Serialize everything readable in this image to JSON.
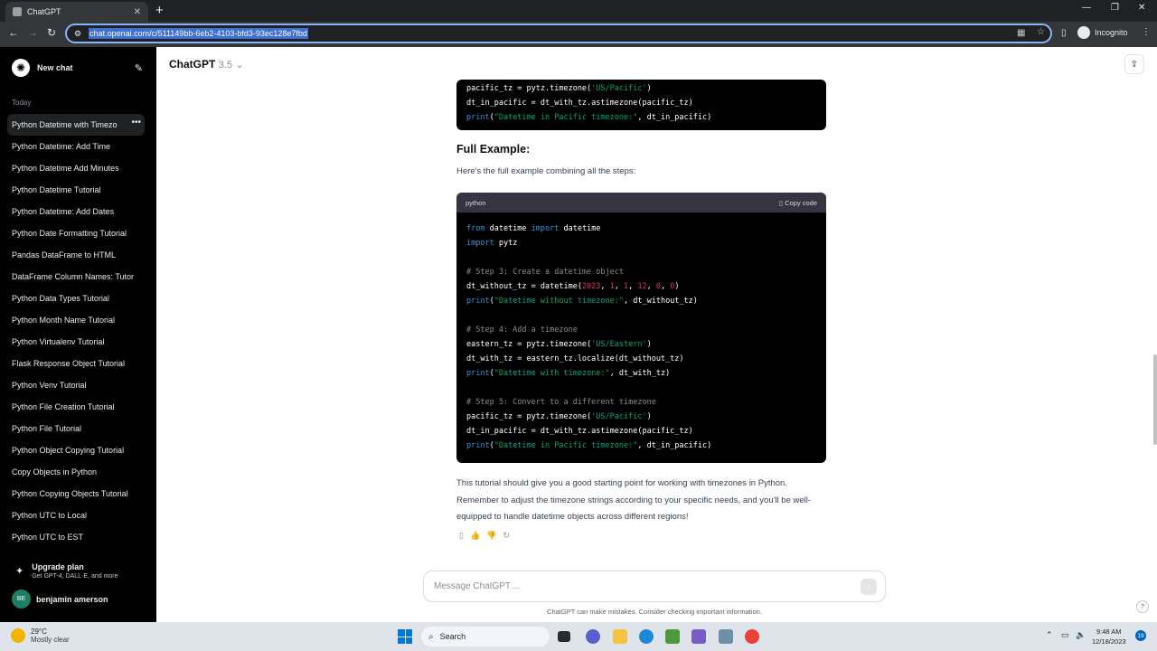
{
  "browser": {
    "tab_title": "ChatGPT",
    "url": "chat.openai.com/c/511149bb-6eb2-4103-bfd3-93ec128e7fbd",
    "profile": "Incognito"
  },
  "sidebar": {
    "new_chat": "New chat",
    "section": "Today",
    "items": [
      "Python Datetime with Timezo",
      "Python Datetime: Add Time",
      "Python Datetime Add Minutes",
      "Python Datetime Tutorial",
      "Python Datetime: Add Dates",
      "Python Date Formatting Tutorial",
      "Pandas DataFrame to HTML",
      "DataFrame Column Names: Tutor",
      "Python Data Types Tutorial",
      "Python Month Name Tutorial",
      "Python Virtualenv Tutorial",
      "Flask Response Object Tutorial",
      "Python Venv Tutorial",
      "Python File Creation Tutorial",
      "Python File Tutorial",
      "Python Object Copying Tutorial",
      "Copy Objects in Python",
      "Python Copying Objects Tutorial",
      "Python UTC to Local",
      "Python UTC to EST"
    ],
    "upgrade_title": "Upgrade plan",
    "upgrade_sub": "Get GPT-4, DALL·E, and more",
    "user_initials": "BE",
    "user_name": "benjamin amerson"
  },
  "header": {
    "model": "ChatGPT",
    "version": "3.5"
  },
  "content": {
    "top_code": [
      "pacific_tz = pytz.timezone('US/Pacific')",
      "dt_in_pacific = dt_with_tz.astimezone(pacific_tz)",
      "print(\"Datetime in Pacific timezone:\", dt_in_pacific)"
    ],
    "heading": "Full Example:",
    "intro": "Here's the full example combining all the steps:",
    "code_lang": "python",
    "copy_label": "Copy code",
    "outro": "This tutorial should give you a good starting point for working with timezones in Python. Remember to adjust the timezone strings according to your specific needs, and you'll be well-equipped to handle datetime objects across different regions!"
  },
  "input": {
    "placeholder": "Message ChatGPT…",
    "disclaimer": "ChatGPT can make mistakes. Consider checking important information."
  },
  "taskbar": {
    "temp": "29°C",
    "condition": "Mostly clear",
    "search": "Search",
    "time": "9:48 AM",
    "date": "12/18/2023",
    "notifications": "19"
  }
}
